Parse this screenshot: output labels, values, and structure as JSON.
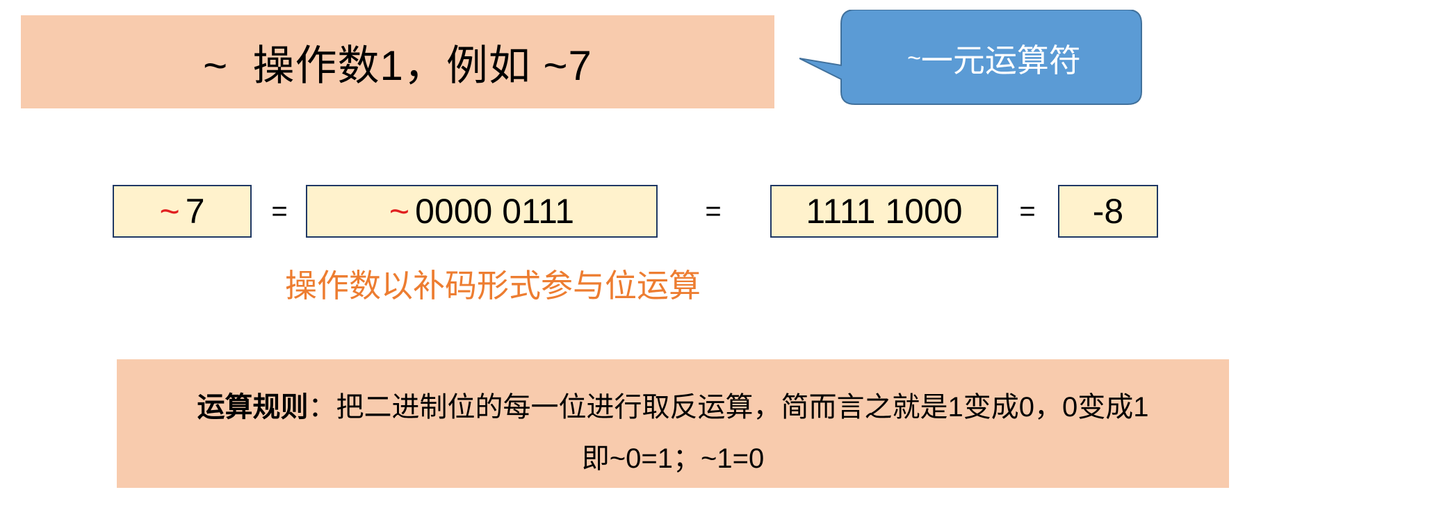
{
  "title": "~  操作数1，例如 ~7",
  "callout": {
    "tilde": "~",
    "text": "一元运算符",
    "fill": "#5b9bd5"
  },
  "equation": {
    "box1": {
      "tilde": "~",
      "value": "7"
    },
    "eq1": "=",
    "box2": {
      "tilde": "~",
      "value": "0000 0111"
    },
    "eq2": "=",
    "box3": "1111 1000",
    "eq3": "=",
    "box4": "-8"
  },
  "note": "操作数以补码形式参与位运算",
  "rule": {
    "label": "运算规则",
    "line1": "：把二进制位的每一位进行取反运算，简而言之就是1变成0，0变成1",
    "line2": "即~0=1；~1=0"
  },
  "colors": {
    "banner": "#f8cbad",
    "box_fill": "#fff2cc",
    "box_border": "#1f3864",
    "tilde_red": "#e02020",
    "note_orange": "#ed7d31"
  }
}
